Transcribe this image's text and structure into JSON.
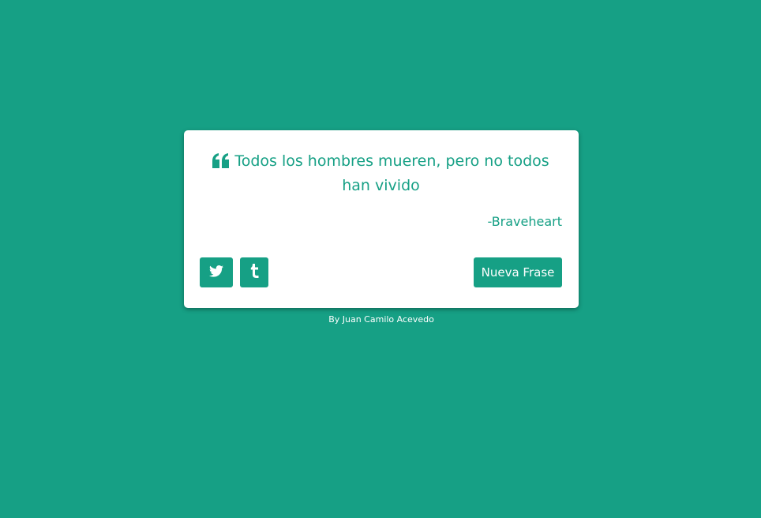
{
  "colors": {
    "background": "#16a085",
    "card": "#ffffff",
    "accent": "#16a085",
    "button_text": "#ffffff"
  },
  "quote": {
    "icon": "quote-left-icon",
    "text": "Todos los hombres mueren, pero no todos han vivido",
    "author": "-Braveheart"
  },
  "actions": {
    "twitter_icon": "twitter-icon",
    "tumblr_icon": "tumblr-icon",
    "new_quote_label": "Nueva Frase"
  },
  "footer": {
    "credit": "By Juan Camilo Acevedo"
  }
}
